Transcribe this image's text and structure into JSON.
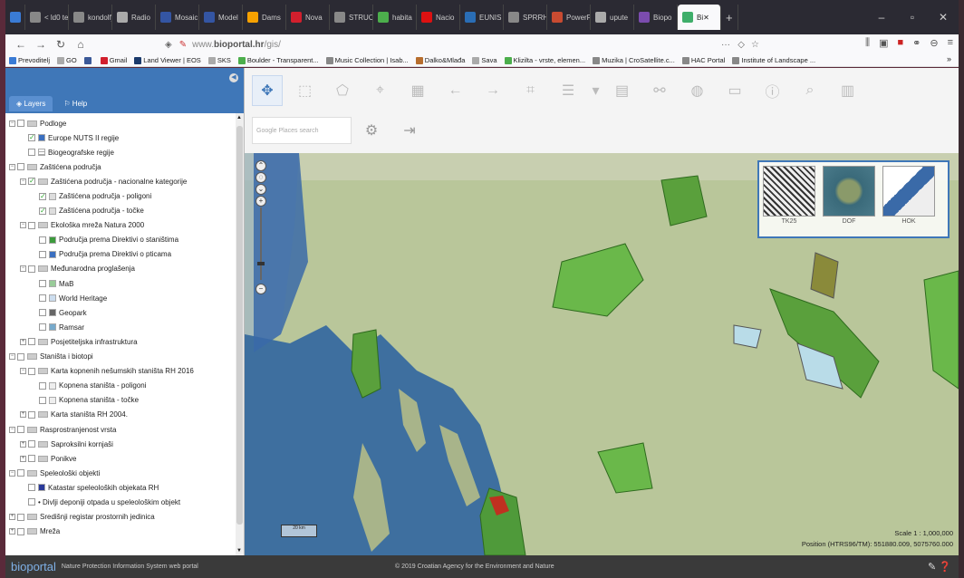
{
  "browser": {
    "tabs": [
      {
        "label": "",
        "color": "#3a7bd5"
      },
      {
        "label": "< ld0 teils",
        "color": "#888"
      },
      {
        "label": "kondolf_5",
        "color": "#888"
      },
      {
        "label": "Radio",
        "color": "#aaa"
      },
      {
        "label": "Mosaic",
        "color": "#3455a3"
      },
      {
        "label": "Model",
        "color": "#3455a3"
      },
      {
        "label": "Dams",
        "color": "#f6a100"
      },
      {
        "label": "Nova",
        "color": "#d21f2d"
      },
      {
        "label": "STRUCNE",
        "color": "#888"
      },
      {
        "label": "habita",
        "color": "#4cae4c"
      },
      {
        "label": "Nacio",
        "color": "#d11"
      },
      {
        "label": "EUNIS",
        "color": "#2a6db5"
      },
      {
        "label": "SPRRH_e-I",
        "color": "#888"
      },
      {
        "label": "PowerPo",
        "color": "#c84b31"
      },
      {
        "label": "upute",
        "color": "#aaa"
      },
      {
        "label": "Biopo",
        "color": "#7b4cae"
      },
      {
        "label": "Bi",
        "color": "#3fae6a",
        "active": true
      }
    ],
    "new_tab": "+",
    "url_prefix": "www.",
    "url_host": "bioportal.hr",
    "url_path": "/gis/",
    "bookmarks": [
      {
        "label": "Prevoditelj",
        "color": "#3a7bd5"
      },
      {
        "label": "GO",
        "color": "#aaa"
      },
      {
        "label": "",
        "color": "#3b5998"
      },
      {
        "label": "Gmail",
        "color": "#d21f2d"
      },
      {
        "label": "Land Viewer | EOS",
        "color": "#1b3a6b"
      },
      {
        "label": "SKS",
        "color": "#aaa"
      },
      {
        "label": "Boulder - Transparent...",
        "color": "#4cae4c"
      },
      {
        "label": "Music Collection | Isab...",
        "color": "#888"
      },
      {
        "label": "Dalko&Mlađa",
        "color": "#b76e2e"
      },
      {
        "label": "Sava",
        "color": "#aaa"
      },
      {
        "label": "Klizilta - vrste, elemen...",
        "color": "#4cae4c"
      },
      {
        "label": "Muzika | CroSatellite.c...",
        "color": "#888"
      },
      {
        "label": "HAC Portal",
        "color": "#888"
      },
      {
        "label": "Institute of Landscape ...",
        "color": "#888"
      }
    ]
  },
  "sidebar": {
    "tab_layers": "Layers",
    "tab_help": "Help",
    "tree": [
      {
        "level": 0,
        "exp": "−",
        "label": "Podloge",
        "checked": false,
        "sym": "folder"
      },
      {
        "level": 1,
        "label": "Europe NUTS II regije",
        "checked": true,
        "sym": "#3a6fc0"
      },
      {
        "level": 1,
        "label": "Biogeografske regije",
        "checked": false,
        "sym": "stripe"
      },
      {
        "level": 0,
        "exp": "−",
        "label": "Zaštićena područja",
        "checked": false,
        "sym": "folder"
      },
      {
        "level": 1,
        "exp": "−",
        "label": "Zaštićena područja - nacionalne kategorije",
        "checked": true,
        "sym": "folder"
      },
      {
        "level": 2,
        "label": "Zaštićena područja - poligoni",
        "checked": true,
        "sym": "#ddd"
      },
      {
        "level": 2,
        "label": "Zaštićena područja - točke",
        "checked": true,
        "sym": "#ddd"
      },
      {
        "level": 1,
        "exp": "−",
        "label": "Ekološka mreža Natura 2000",
        "checked": false,
        "sym": "folder"
      },
      {
        "level": 2,
        "label": "Područja prema Direktivi o staništima",
        "checked": false,
        "sym": "#3c9a3c"
      },
      {
        "level": 2,
        "label": "Područja prema Direktivi o pticama",
        "checked": false,
        "sym": "#3a6fc0"
      },
      {
        "level": 1,
        "exp": "−",
        "label": "Međunarodna proglašenja",
        "checked": false,
        "sym": "folder"
      },
      {
        "level": 2,
        "label": "MaB",
        "checked": false,
        "sym": "#9c9"
      },
      {
        "level": 2,
        "label": "World Heritage",
        "checked": false,
        "sym": "#cde"
      },
      {
        "level": 2,
        "label": "Geopark",
        "checked": false,
        "sym": "#666"
      },
      {
        "level": 2,
        "label": "Ramsar",
        "checked": false,
        "sym": "#7ac"
      },
      {
        "level": 1,
        "exp": "+",
        "label": "Posjetiteljska infrastruktura",
        "checked": false,
        "sym": "folder"
      },
      {
        "level": 0,
        "exp": "−",
        "label": "Staništa i biotopi",
        "checked": false,
        "sym": "folder"
      },
      {
        "level": 1,
        "exp": "−",
        "label": "Karta kopnenih nešumskih staništa RH 2016",
        "checked": false,
        "sym": "folder"
      },
      {
        "level": 2,
        "label": "Kopnena staništa - poligoni",
        "checked": false,
        "sym": "#eee"
      },
      {
        "level": 2,
        "label": "Kopnena staništa - točke",
        "checked": false,
        "sym": "#eee"
      },
      {
        "level": 1,
        "exp": "+",
        "label": "Karta staništa RH 2004.",
        "checked": false,
        "sym": "folder"
      },
      {
        "level": 0,
        "exp": "−",
        "label": "Rasprostranjenost vrsta",
        "checked": false,
        "sym": "folder"
      },
      {
        "level": 1,
        "exp": "+",
        "label": "Saproksilni kornjaši",
        "checked": false,
        "sym": "folder"
      },
      {
        "level": 1,
        "exp": "+",
        "label": "Ponikve",
        "checked": false,
        "sym": "folder"
      },
      {
        "level": 0,
        "exp": "−",
        "label": "Speleološki objekti",
        "checked": false,
        "sym": "folder"
      },
      {
        "level": 1,
        "label": "Katastar speleoloških objekata RH",
        "checked": false,
        "sym": "#2a3a9a"
      },
      {
        "level": 1,
        "label": "• Divlji deponiji otpada u speleološkim objekt",
        "checked": false,
        "sym": "none"
      },
      {
        "level": 0,
        "exp": "+",
        "label": "Središnji registar prostornih jedinica",
        "checked": false,
        "sym": "folder"
      },
      {
        "level": 0,
        "exp": "+",
        "label": "Mreža",
        "checked": false,
        "sym": "folder"
      }
    ]
  },
  "toolbar": {
    "icons": [
      {
        "name": "pan-tool-icon",
        "glyph": "✥",
        "active": true
      },
      {
        "name": "select-tool-icon",
        "glyph": "⬚"
      },
      {
        "name": "measure-area-icon",
        "glyph": "⬠"
      },
      {
        "name": "measure-coord-icon",
        "glyph": "⌖"
      },
      {
        "name": "zoom-extent-icon",
        "glyph": "▦"
      },
      {
        "name": "back-arrow-icon",
        "glyph": "←"
      },
      {
        "name": "forward-arrow-icon",
        "glyph": "→"
      },
      {
        "name": "identify-icon",
        "glyph": "⌗"
      },
      {
        "name": "layer-list-icon",
        "glyph": "☰"
      },
      {
        "name": "dropdown-icon",
        "glyph": "▾"
      },
      {
        "name": "document-icon",
        "glyph": "▤"
      },
      {
        "name": "link-icon",
        "glyph": "⚯"
      },
      {
        "name": "globe-icon",
        "glyph": "◍"
      },
      {
        "name": "print-icon",
        "glyph": "▭"
      },
      {
        "name": "info-icon",
        "glyph": "ⓘ"
      },
      {
        "name": "search-icon",
        "glyph": "⌕"
      },
      {
        "name": "report-icon",
        "glyph": "▥"
      }
    ],
    "search_placeholder": "Google Places search",
    "settings_glyph": "⚙",
    "export_glyph": "⇥"
  },
  "map": {
    "basemaps": [
      "TK25",
      "DOF",
      "HOK"
    ],
    "scale_bar_text": "20 km",
    "scale_text": "Scale 1 : 1,000,000",
    "position_text": "Position (HTRS96/TM):  551880.009, 5075760.000"
  },
  "footer": {
    "brand": "bioportal",
    "tagline": "Nature Protection Information System web portal",
    "copyright": "© 2019 Croatian Agency for the Environment and Nature"
  }
}
